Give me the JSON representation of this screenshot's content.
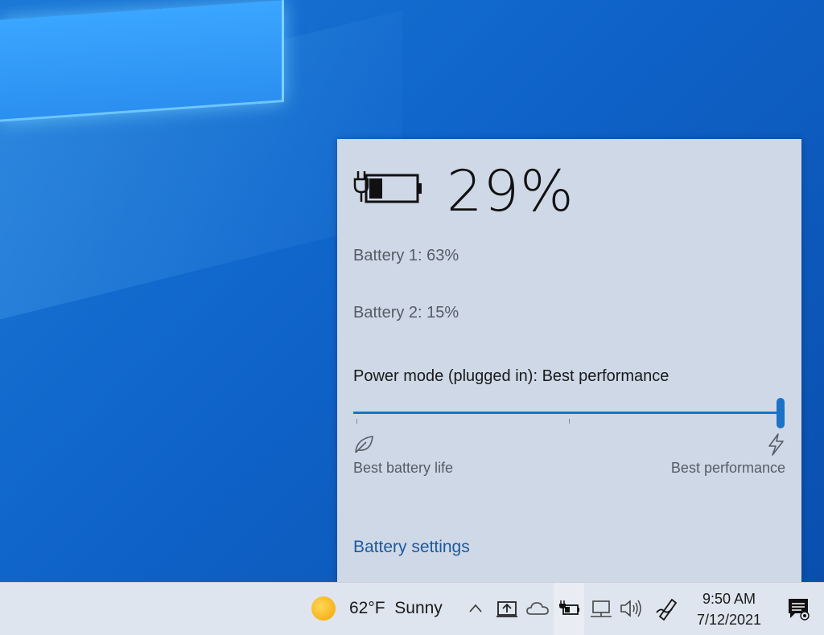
{
  "flyout": {
    "battery_percent": "29%",
    "battery_level": 0.29,
    "battery_1": "Battery 1: 63%",
    "battery_2": "Battery 2: 15%",
    "power_mode": "Power mode (plugged in): Best performance",
    "slider_value": 1.0,
    "range_left_label": "Best battery life",
    "range_right_label": "Best performance",
    "settings_link": "Battery settings"
  },
  "taskbar": {
    "weather_text": "62°F  Sunny",
    "time": "9:50 AM",
    "date": "7/12/2021",
    "tray_icons": [
      "chevron-up-icon",
      "project-display-icon",
      "onedrive-cloud-icon",
      "battery-charging-icon",
      "network-icon",
      "volume-icon",
      "pen-workspace-icon",
      "action-center-icon"
    ]
  },
  "colors": {
    "accent": "#1a72c9",
    "link": "#1a5a9e",
    "flyout_bg": "#cfd8e6",
    "taskbar_bg": "#dfe5ee"
  }
}
